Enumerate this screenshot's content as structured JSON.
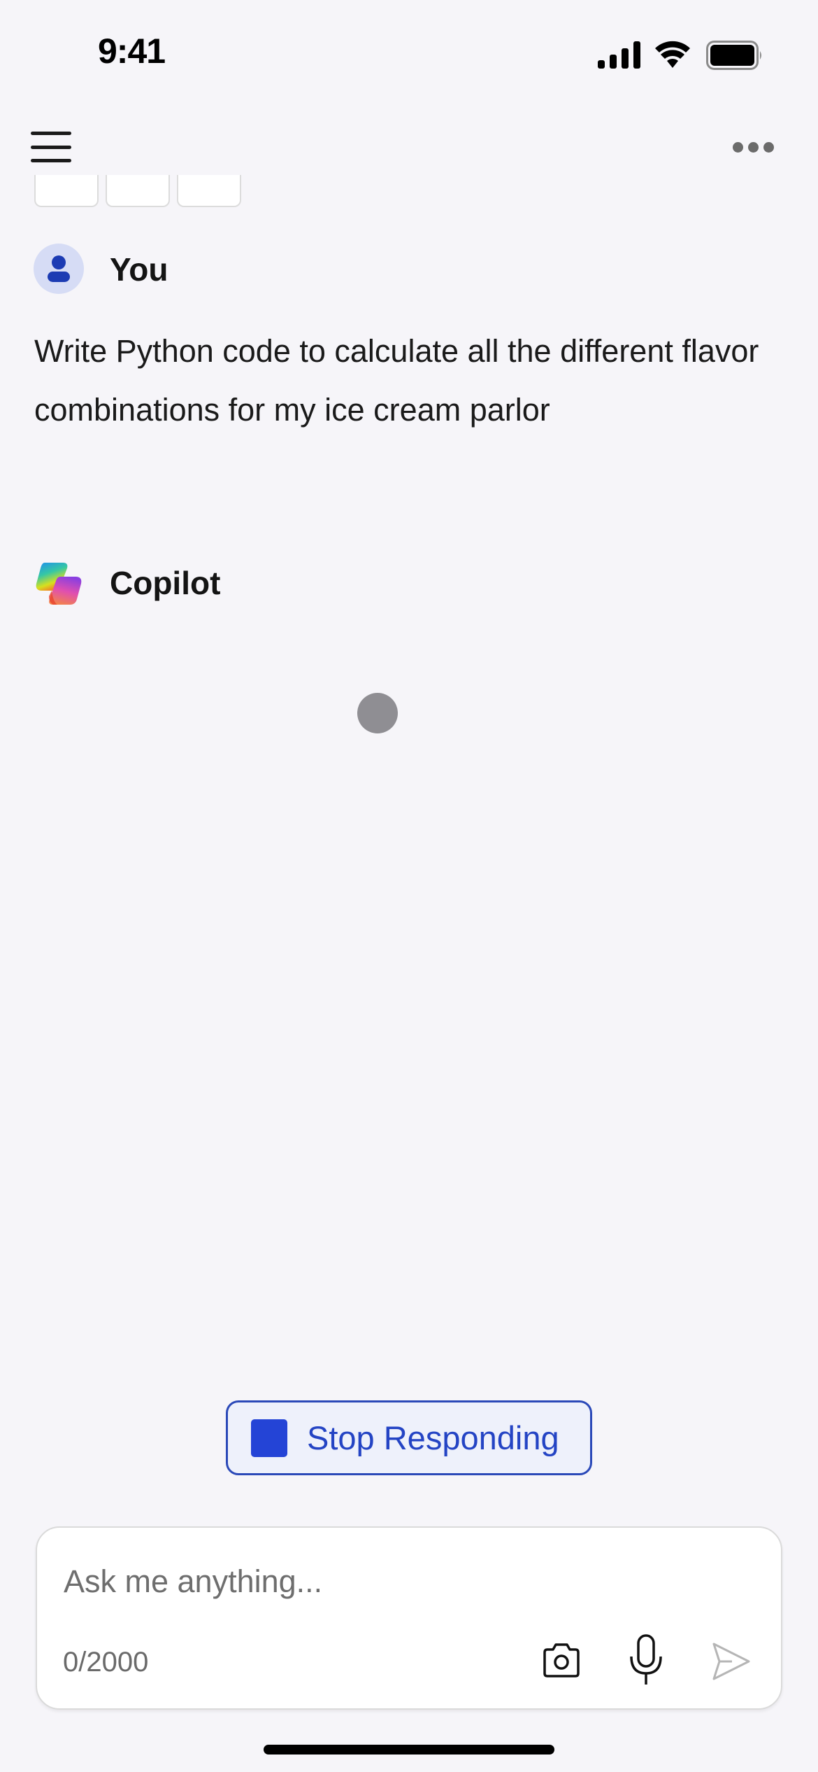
{
  "status_bar": {
    "time": "9:41",
    "icons": [
      "cellular-signal-icon",
      "wifi-icon",
      "battery-icon"
    ]
  },
  "header": {
    "menu_icon": "hamburger-menu-icon",
    "more_icon": "more-horizontal-icon"
  },
  "conversation": {
    "user": {
      "name": "You",
      "avatar_icon": "person-icon",
      "message": "Write Python code to calculate all the different flavor combinations for my ice cream parlor"
    },
    "assistant": {
      "name": "Copilot",
      "logo_icon": "copilot-logo-icon",
      "state": "typing"
    }
  },
  "stop_button": {
    "label": "Stop Responding",
    "icon": "stop-square-icon"
  },
  "composer": {
    "placeholder": "Ask me anything...",
    "value": "",
    "counter": "0/2000",
    "actions": [
      "camera-icon",
      "microphone-icon",
      "send-icon"
    ]
  },
  "colors": {
    "background": "#f6f5f9",
    "accent": "#2444d6",
    "avatar_bg": "#d6dcf5",
    "typing_dot": "#8f8e93"
  }
}
